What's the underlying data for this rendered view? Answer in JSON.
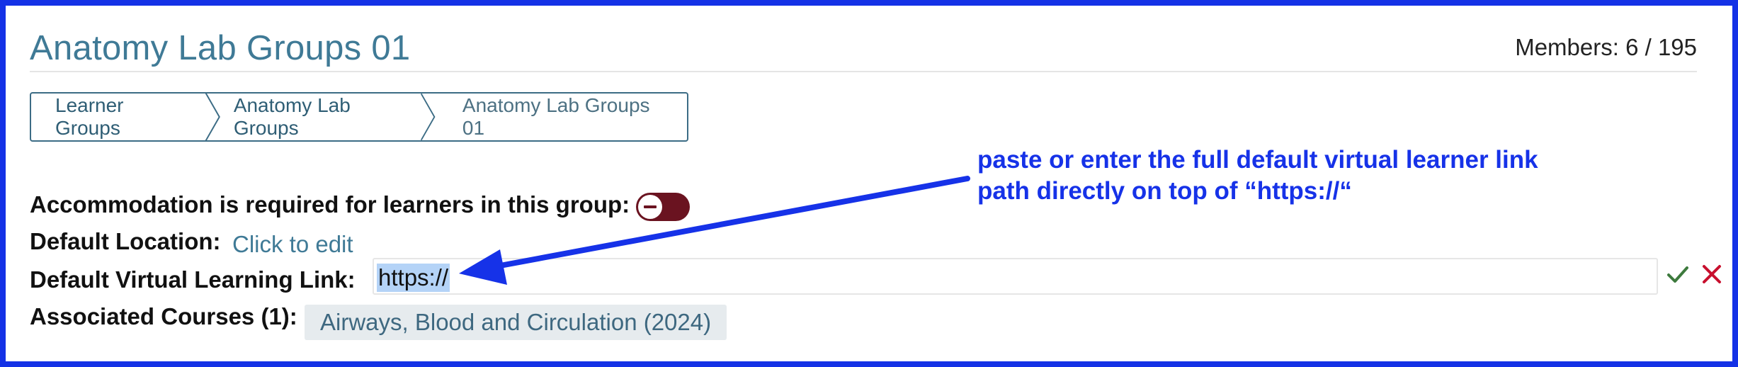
{
  "header": {
    "title": "Anatomy Lab Groups 01",
    "members": "Members: 6 / 195"
  },
  "breadcrumb": {
    "items": [
      "Learner Groups",
      "Anatomy Lab Groups",
      "Anatomy Lab Groups 01"
    ]
  },
  "details": {
    "accommodation_label": "Accommodation is required for learners in this group:",
    "accommodation_required": false,
    "location_label": "Default Location:",
    "location_value": "Click to edit",
    "virtual_link_label": "Default Virtual Learning Link:",
    "virtual_link_value": "https://",
    "courses_label": "Associated Courses (1):",
    "courses": [
      "Airways, Blood and Circulation (2024)"
    ]
  },
  "annotation": {
    "line1": "paste or enter the full default virtual learner link",
    "line2": "path directly on top of “https://“"
  },
  "colors": {
    "frame": "#1432e6",
    "title": "#3f7a96",
    "toggle_off": "#6a1320",
    "confirm": "#3d7a3d",
    "cancel": "#c8102e",
    "annotation": "#1632e8"
  },
  "icons": {
    "confirm": "checkmark-icon",
    "cancel": "close-icon",
    "toggle_knob": "minus-icon"
  }
}
